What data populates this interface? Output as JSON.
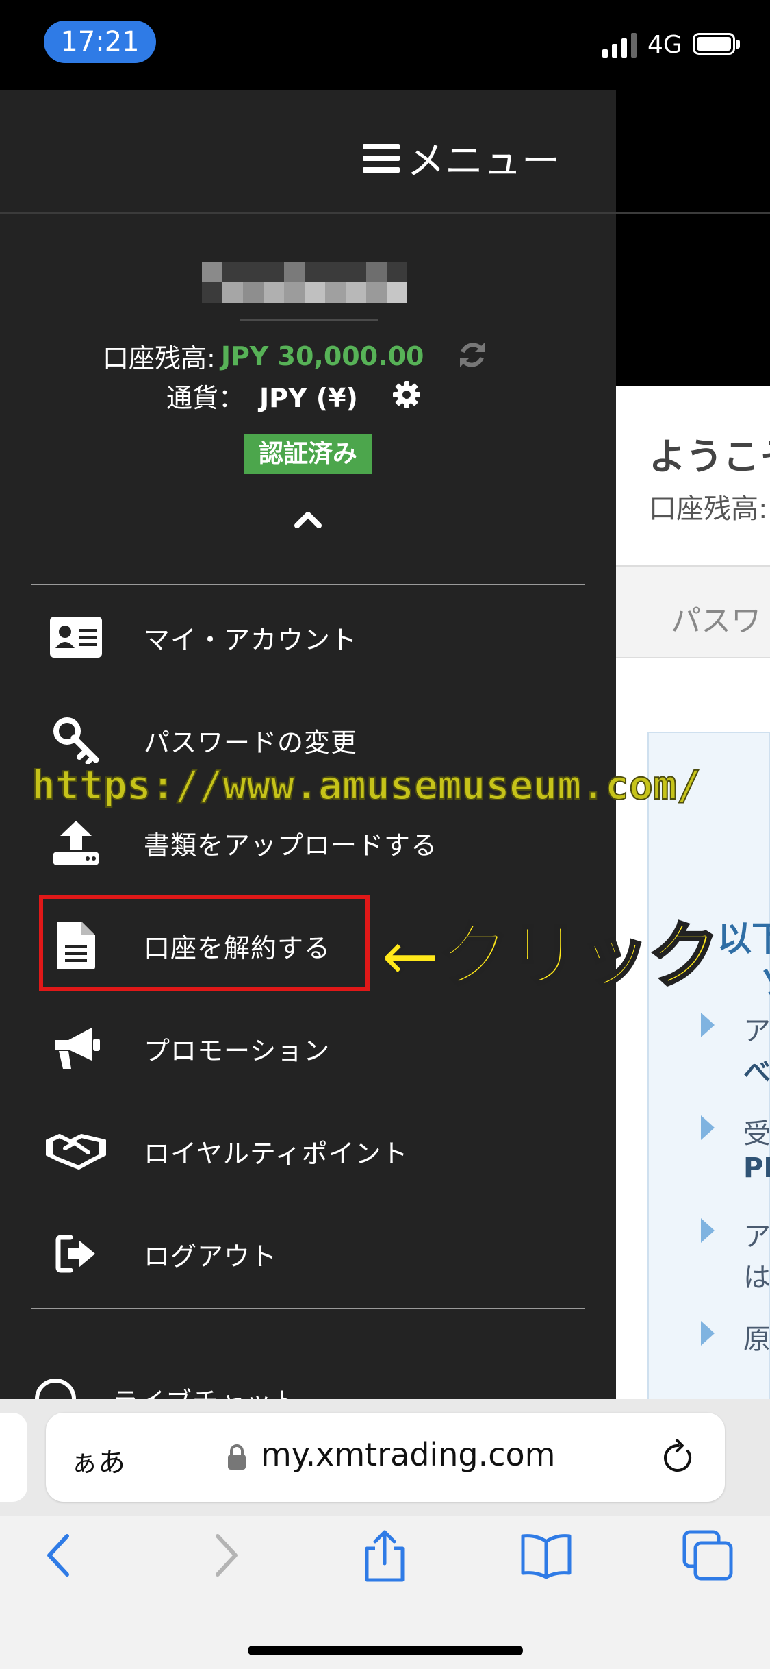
{
  "status_bar": {
    "time": "17:21",
    "network": "4G"
  },
  "background_page": {
    "welcome": "ようこそ",
    "balance_label": "口座残高:",
    "tab_label": "パスワ",
    "heading": "以下",
    "heading_fragment": "ソ",
    "bullets": [
      {
        "line1": "ア",
        "line2": "べ"
      },
      {
        "line1": "受",
        "line2": "PN"
      },
      {
        "line1": "ア",
        "line2": "は"
      },
      {
        "line1": "原",
        "line2": ""
      }
    ]
  },
  "menu": {
    "title": "メニュー",
    "account": {
      "balance_label": "口座残高:",
      "balance_value": "JPY 30,000.00",
      "currency_label": "通貨：",
      "currency_value": "JPY (¥)",
      "verified": "認証済み"
    },
    "items": [
      {
        "label": "マイ・アカウント",
        "icon": "id-card-icon"
      },
      {
        "label": "パスワードの変更",
        "icon": "key-icon"
      },
      {
        "label": "書類をアップロードする",
        "icon": "upload-icon"
      },
      {
        "label": "口座を解約する",
        "icon": "document-icon"
      },
      {
        "label": "プロモーション",
        "icon": "megaphone-icon"
      },
      {
        "label": "ロイヤルティポイント",
        "icon": "handshake-icon"
      },
      {
        "label": "ログアウト",
        "icon": "logout-icon"
      }
    ],
    "live_chat": {
      "label": "ライブチャット",
      "icon": "headset-icon"
    }
  },
  "annotations": {
    "watermark": "https://www.amusemuseum.com/",
    "click": "←クリック"
  },
  "safari": {
    "aa": "ぁあ",
    "url": "my.xmtrading.com"
  },
  "colors": {
    "menu_bg": "#232323",
    "balance_green": "#57b257",
    "verified_green": "#4ca64c",
    "highlight_red": "#e01818",
    "annotation_yellow": "#ffe81a",
    "ios_blue": "#2f7be6"
  }
}
